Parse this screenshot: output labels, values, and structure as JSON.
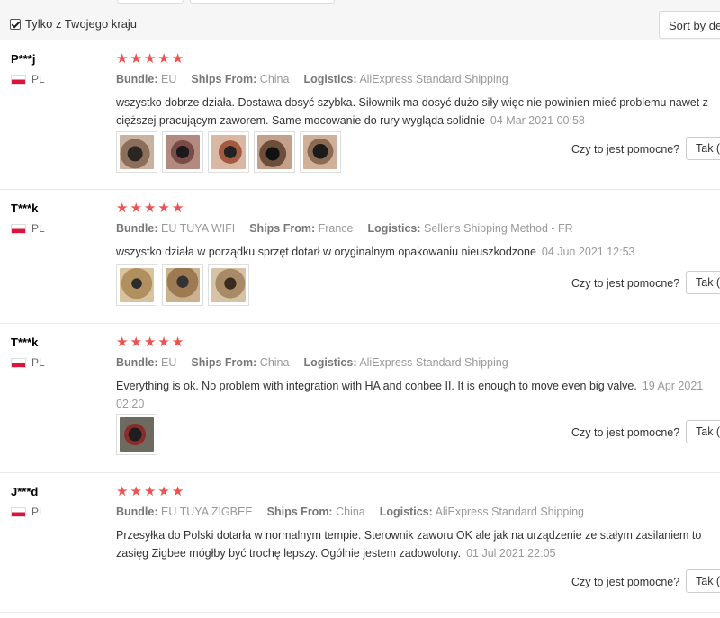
{
  "filter": {
    "only_my_country_label": "Tylko z Twojego kraju",
    "checked": true
  },
  "sort": {
    "label": "Sort by de"
  },
  "meta_labels": {
    "bundle": "Bundle:",
    "ships_from": "Ships From:",
    "logistics": "Logistics:"
  },
  "helpful_question": "Czy to jest pomocne?",
  "helpful_yes_label": "Tak (",
  "colors": {
    "star": "#f05050",
    "meta_value": "#999999",
    "date": "#999999"
  },
  "reviews": [
    {
      "user": "P***j",
      "country": "PL",
      "rating": 5,
      "bundle": "EU",
      "ships_from": "China",
      "logistics": "AliExpress Standard Shipping",
      "text": "wszystko dobrze działa. Dostawa dosyć szybka. Siłownik ma dosyć dużo siły więc nie powinien mieć problemu nawet z cięższej pracującym zaworem. Same mocowanie do rury wygląda solidnie",
      "date": "04 Mar 2021 00:58",
      "photos": 5
    },
    {
      "user": "T***k",
      "country": "PL",
      "rating": 5,
      "bundle": "EU TUYA WIFI",
      "ships_from": "France",
      "logistics": "Seller's Shipping Method - FR",
      "text": "wszystko działa w porządku sprzęt dotarł w oryginalnym opakowaniu nieuszkodzone",
      "date": "04 Jun 2021 12:53",
      "photos": 3
    },
    {
      "user": "T***k",
      "country": "PL",
      "rating": 5,
      "bundle": "EU",
      "ships_from": "China",
      "logistics": "AliExpress Standard Shipping",
      "text": "Everything is ok. No problem with integration with HA and conbee II. It is enough to move even big valve.",
      "date": "19 Apr 2021 02:20",
      "photos": 1
    },
    {
      "user": "J***d",
      "country": "PL",
      "rating": 5,
      "bundle": "EU TUYA ZIGBEE",
      "ships_from": "China",
      "logistics": "AliExpress Standard Shipping",
      "text": "Przesyłka do Polski dotarła w normalnym tempie. Sterownik zaworu OK ale jak na urządzenie ze stałym zasilaniem to zasięg Zigbee mógłby być trochę lepszy. Ogólnie jestem zadowolony.",
      "date": "01 Jul 2021 22:05",
      "photos": 0
    }
  ]
}
